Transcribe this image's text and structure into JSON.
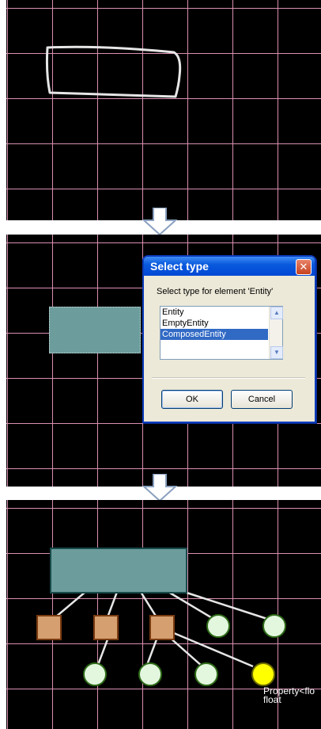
{
  "dialog": {
    "title": "Select type",
    "close_glyph": "✕",
    "prompt": "Select type for element 'Entity'",
    "options": [
      "Entity",
      "EmptyEntity",
      "ComposedEntity"
    ],
    "selected": "ComposedEntity",
    "ok_label": "OK",
    "cancel_label": "Cancel"
  },
  "diagram": {
    "property_label": "Property<flo",
    "property_type": "float"
  },
  "colors": {
    "grid": "#d98fb0",
    "entity_fill": "#6c9c9c",
    "square_fill": "#d59f6f",
    "circle_fill": "#e3f7df",
    "circle_selected_fill": "#ffff00"
  }
}
